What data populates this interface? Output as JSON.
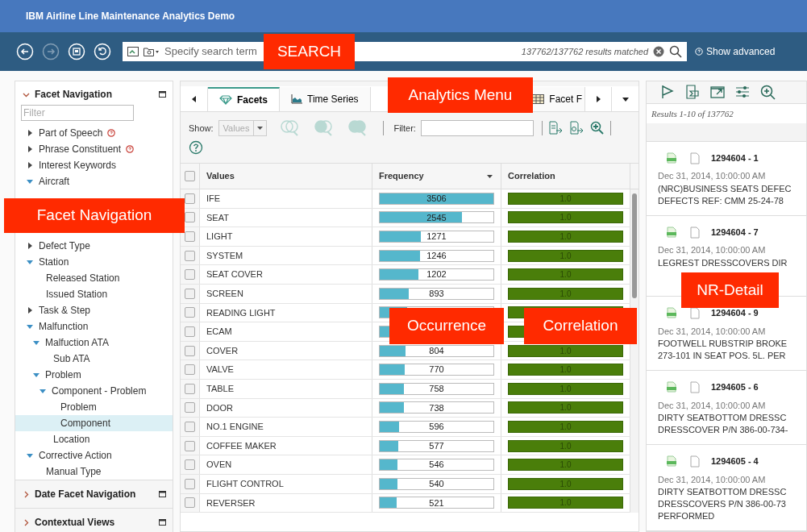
{
  "app_title": "IBM Airline Line Maintenance Analytics Demo",
  "search": {
    "placeholder": "Specify search term",
    "result_count": "137762/137762 results matched",
    "show_advanced": "Show advanced"
  },
  "callouts": [
    {
      "label": "SEARCH"
    },
    {
      "label": "Facet Navigation"
    },
    {
      "label": "Analytics Menu"
    },
    {
      "label": "Occurrence"
    },
    {
      "label": "Correlation"
    },
    {
      "label": "NR-Detail"
    }
  ],
  "sidebar": {
    "sections": [
      {
        "title": "Facet Navigation",
        "expanded": true,
        "filter_placeholder": "Filter",
        "tree": [
          {
            "label": "Part of Speech",
            "kind": "group",
            "expanded": false,
            "help": true,
            "selected": false
          },
          {
            "label": "Phrase Constituent",
            "kind": "group",
            "expanded": false,
            "help": true,
            "selected": false
          },
          {
            "label": "Interest Keywords",
            "kind": "group",
            "expanded": false,
            "help": false,
            "selected": false
          },
          {
            "label": "Aircraft",
            "kind": "group",
            "expanded": true,
            "help": false,
            "selected": false
          },
          {
            "label": "Defect Type",
            "kind": "group",
            "expanded": false,
            "help": false,
            "selected": false
          },
          {
            "label": "Station",
            "kind": "group",
            "expanded": true,
            "help": false,
            "selected": false,
            "children": [
              {
                "label": "Released Station",
                "kind": "leaf",
                "selected": false
              },
              {
                "label": "Issued Station",
                "kind": "leaf",
                "selected": false
              }
            ]
          },
          {
            "label": "Task & Step",
            "kind": "group",
            "expanded": false,
            "help": false,
            "selected": false
          },
          {
            "label": "Malfunction",
            "kind": "group",
            "expanded": true,
            "help": false,
            "selected": false,
            "children": [
              {
                "label": "Malfuction ATA",
                "kind": "group",
                "expanded": true,
                "help": false,
                "selected": false,
                "children": [
                  {
                    "label": "Sub ATA",
                    "kind": "leaf",
                    "selected": false
                  }
                ]
              },
              {
                "label": "Problem",
                "kind": "group",
                "expanded": true,
                "help": false,
                "selected": false,
                "children": [
                  {
                    "label": "Component - Problem",
                    "kind": "group",
                    "expanded": true,
                    "help": false,
                    "selected": false,
                    "children": [
                      {
                        "label": "Problem",
                        "kind": "leaf",
                        "selected": false
                      },
                      {
                        "label": "Component",
                        "kind": "leaf",
                        "selected": true
                      }
                    ]
                  },
                  {
                    "label": "Location",
                    "kind": "leaf",
                    "selected": false
                  }
                ]
              }
            ]
          },
          {
            "label": "Corrective Action",
            "kind": "group",
            "expanded": true,
            "help": false,
            "selected": false,
            "children": [
              {
                "label": "Manual Type",
                "kind": "leaf",
                "selected": false
              }
            ]
          }
        ]
      },
      {
        "title": "Date Facet Navigation",
        "expanded": false
      },
      {
        "title": "Contextual Views",
        "expanded": false
      }
    ]
  },
  "analytics": {
    "tabs": [
      {
        "label": "Facets",
        "kind": "facets",
        "selected": true
      },
      {
        "label": "Time Series",
        "kind": "timeseries",
        "selected": false
      },
      {
        "label": "Facet F",
        "kind": "table",
        "selected": false
      }
    ],
    "show_label": "Show:",
    "show_value": "Values",
    "filter_label": "Filter:",
    "table": {
      "select_all_checked": false,
      "columns": [
        "Values",
        "Frequency",
        "Correlation"
      ],
      "rows": [
        {
          "value": "IFE",
          "checked": false,
          "frequency": "3506",
          "level": 1,
          "correlation": "1.0"
        },
        {
          "value": "SEAT",
          "checked": false,
          "frequency": "2545",
          "level": 0.726,
          "correlation": "1.0"
        },
        {
          "value": "LIGHT",
          "checked": false,
          "frequency": "1271",
          "level": 0.363,
          "correlation": "1.0"
        },
        {
          "value": "SYSTEM",
          "checked": false,
          "frequency": "1246",
          "level": 0.355,
          "correlation": "1.0"
        },
        {
          "value": "SEAT COVER",
          "checked": false,
          "frequency": "1202",
          "level": 0.343,
          "correlation": "1.0"
        },
        {
          "value": "SCREEN",
          "checked": false,
          "frequency": "893",
          "level": 0.255,
          "correlation": "1.0"
        },
        {
          "value": "READING LIGHT",
          "checked": false,
          "level": 0.24
        },
        {
          "value": "ECAM",
          "checked": false,
          "level": 0.232
        },
        {
          "value": "COVER",
          "checked": false,
          "frequency": "804",
          "level": 0.229,
          "correlation": "1.0"
        },
        {
          "value": "VALVE",
          "checked": false,
          "frequency": "770",
          "level": 0.22,
          "correlation": "1.0"
        },
        {
          "value": "TABLE",
          "checked": false,
          "frequency": "758",
          "level": 0.216,
          "correlation": "1.0"
        },
        {
          "value": "DOOR",
          "checked": false,
          "frequency": "738",
          "level": 0.21,
          "correlation": "1.0"
        },
        {
          "value": "NO.1 ENGINE",
          "checked": false,
          "frequency": "596",
          "level": 0.17,
          "correlation": "1.0"
        },
        {
          "value": "COFFEE MAKER",
          "checked": false,
          "frequency": "577",
          "level": 0.165,
          "correlation": "1.0"
        },
        {
          "value": "OVEN",
          "checked": false,
          "frequency": "546",
          "level": 0.156,
          "correlation": "1.0"
        },
        {
          "value": "FLIGHT CONTROL",
          "checked": false,
          "frequency": "540",
          "level": 0.154,
          "correlation": "1.0"
        },
        {
          "value": "REVERSER",
          "checked": false,
          "frequency": "521",
          "level": 0.149,
          "correlation": "1.0"
        }
      ]
    }
  },
  "results": {
    "summary": "Results 1-10 of 137762",
    "items": [
      {
        "id": "1294604 - 1",
        "date": "Dec 31, 2014, 10:00:00 AM",
        "lines": [
          "(NRC)BUSINESS SEATS DEFEC",
          "DEFECTS REF: CMM 25-24-78"
        ]
      },
      {
        "id": "1294604 - 7",
        "date": "Dec 31, 2014, 10:00:00 AM",
        "lines": [
          "LEGREST DRESSCOVERS DIR"
        ]
      },
      {
        "id": "1294604 - 9",
        "date": "Dec 31, 2014, 10:00:00 AM",
        "lines": [
          "FOOTWELL RUBSTRIP BROKE",
          "273-101 IN SEAT POS. 5L. PER"
        ]
      },
      {
        "id": "1294605 - 6",
        "date": "Dec 31, 2014, 10:00:00 AM",
        "lines": [
          "DIRTY SEATBOTTOM DRESSC",
          "DRESSCOVER P/N 386-00-734-"
        ]
      },
      {
        "id": "1294605 - 4",
        "date": "Dec 31, 2014, 10:00:00 AM",
        "lines": [
          "DIRTY SEATBOTTOM DRESSC",
          "DRESSCOVERS P/N 386-00-73",
          "PERFORMED"
        ]
      }
    ]
  }
}
